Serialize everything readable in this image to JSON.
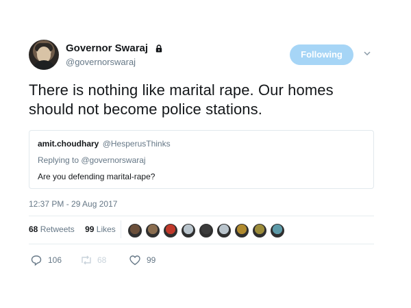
{
  "profile": {
    "display_name": "Governor Swaraj",
    "handle": "@governorswaraj",
    "protected_icon": "lock-icon",
    "follow_label": "Following",
    "menu_icon": "chevron-down-icon"
  },
  "tweet": {
    "line1": "There is nothing like marital rape. Our homes",
    "line2": "should not become police stations."
  },
  "quote": {
    "name": "amit.choudhary",
    "handle": "@HesperusThinks",
    "replying_to": "Replying to @governorswaraj",
    "text": "Are you defending marital-rape?"
  },
  "timestamp": "12:37 PM - 29 Aug 2017",
  "stats": {
    "retweets_count": "68",
    "retweets_label": "Retweets",
    "likes_count": "99",
    "likes_label": "Likes"
  },
  "liker_avatars": [
    {
      "color": "#6b4f3a"
    },
    {
      "color": "#8a6d4f"
    },
    {
      "color": "#c0392b"
    },
    {
      "color": "#b9c4cc"
    },
    {
      "color": "#3b3b3b"
    },
    {
      "color": "#b9c4cc"
    },
    {
      "color": "#b08a2e"
    },
    {
      "color": "#9c8c3a"
    },
    {
      "color": "#5d9aa8"
    }
  ],
  "actions": {
    "reply_count": "106",
    "retweet_count": "68",
    "like_count": "99"
  },
  "colors": {
    "follow_button_bg": "#a6d5f6",
    "secondary_text": "#657786",
    "border": "#e1e8ed"
  }
}
